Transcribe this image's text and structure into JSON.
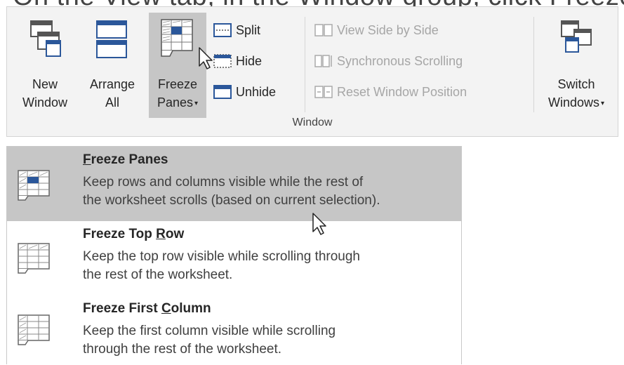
{
  "header_text": "On the View tab, in the Window group, click Freeze",
  "ribbon": {
    "group_label": "Window",
    "new_window": {
      "line1": "New",
      "line2": "Window"
    },
    "arrange_all": {
      "line1": "Arrange",
      "line2": "All"
    },
    "freeze_panes": {
      "line1": "Freeze",
      "line2": "Panes",
      "caret": "▾"
    },
    "split": "Split",
    "hide": "Hide",
    "unhide": "Unhide",
    "view_side_by_side": "View Side by Side",
    "synchronous_scrolling": "Synchronous Scrolling",
    "reset_window_position": "Reset Window Position",
    "switch_windows": {
      "line1": "Switch",
      "line2": "Windows",
      "caret": "▾"
    }
  },
  "menu": {
    "items": [
      {
        "title_mnemonic": "F",
        "title_rest": "reeze Panes",
        "desc_line1": "Keep rows and columns visible while the rest of",
        "desc_line2": "the worksheet scrolls (based on current selection).",
        "icon": "freeze-panes-icon",
        "highlighted": true
      },
      {
        "title_pre": "Freeze Top ",
        "title_mnemonic": "R",
        "title_rest": "ow",
        "desc_line1": "Keep the top row visible while scrolling through",
        "desc_line2": "the rest of the worksheet.",
        "icon": "freeze-top-row-icon"
      },
      {
        "title_pre": "Freeze First ",
        "title_mnemonic": "C",
        "title_rest": "olumn",
        "desc_line1": "Keep the first column visible while scrolling",
        "desc_line2": "through the rest of the worksheet.",
        "icon": "freeze-first-column-icon"
      }
    ]
  },
  "colors": {
    "ribbon_bg": "#f3f3f3",
    "highlight": "#c6c6c6",
    "accent_blue": "#2b579a",
    "disabled_text": "#a6a6a6"
  }
}
